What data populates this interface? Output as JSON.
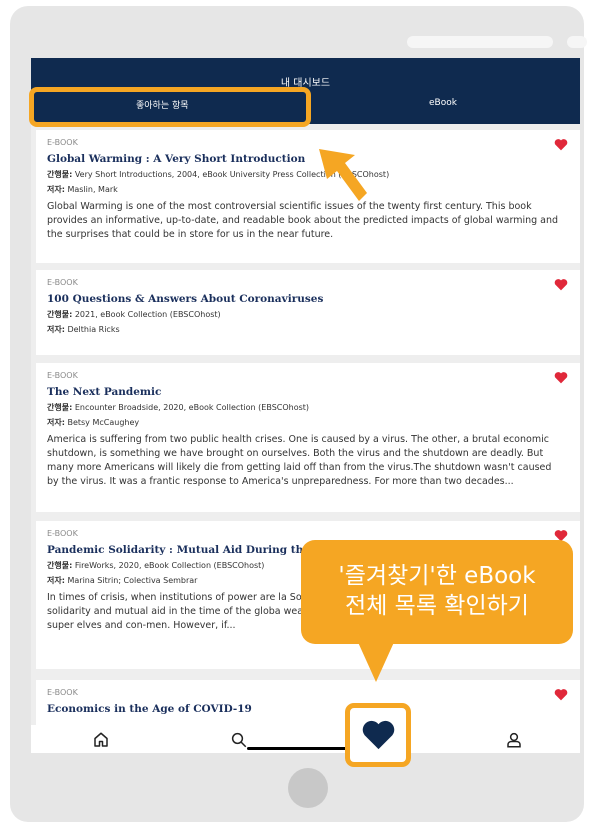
{
  "dashboard": {
    "title": "내 대시보드",
    "tabs": [
      {
        "label": "좋아하는 항목"
      },
      {
        "label": "eBook"
      }
    ]
  },
  "items": [
    {
      "type": "E-BOOK",
      "title": "Global Warming : A Very Short Introduction",
      "pub_label": "간행물:",
      "pub": "Very Short Introductions, 2004, eBook University Press Collection (EBSCOhost)",
      "author_label": "저자:",
      "author": "Maslin, Mark",
      "desc": "Global Warming is one of the most controversial scientific issues of the twenty first century. This book provides an informative, up-to-date, and readable book about the predicted impacts of global warming and the surprises that could be in store for us in the near future."
    },
    {
      "type": "E-BOOK",
      "title": "100 Questions & Answers About Coronaviruses",
      "pub_label": "간행물:",
      "pub": "2021, eBook Collection (EBSCOhost)",
      "author_label": "저자:",
      "author": "Delthia Ricks"
    },
    {
      "type": "E-BOOK",
      "title": "The Next Pandemic",
      "pub_label": "간행물:",
      "pub": "Encounter Broadside, 2020, eBook Collection (EBSCOhost)",
      "author_label": "저자:",
      "author": "Betsy McCaughey",
      "desc": "America is suffering from two public health crises. One is caused by a virus. The other, a brutal economic shutdown, is something we have brought on ourselves. Both the virus and the shutdown are deadly. But many more Americans will likely die from getting laid off than from the virus.The shutdown wasn't caused by the virus. It was a frantic response to America's unpreparedness. For more than two decades..."
    },
    {
      "type": "E-BOOK",
      "title": "Pandemic Solidarity : Mutual Aid During the Co",
      "pub_label": "간행물:",
      "pub": "FireWorks, 2020, eBook Collection (EBSCOhost)",
      "author_label": "저자:",
      "author": "Marina Sitrin; Colectiva Sembrar",
      "desc": "In times of crisis, when institutions of power are la Solidarity collects firsthand experiences from arou of solidarity and mutual aid in the time of the globa weave a narrative of selfish individualism, full of empty super elves and con-men. However, if..."
    },
    {
      "type": "E-BOOK",
      "title": "Economics in the Age of COVID-19"
    }
  ],
  "callout": {
    "line1": "'즐겨찾기'한 eBook",
    "line2": "전체 목록 확인하기"
  },
  "colors": {
    "header": "#0f2a4f",
    "accent": "#f5a623",
    "heart": "#e0283a",
    "title": "#1a2f5c"
  },
  "icons": {
    "favorite": "heart-icon",
    "home": "home-icon",
    "search": "search-icon",
    "profile": "profile-icon"
  }
}
